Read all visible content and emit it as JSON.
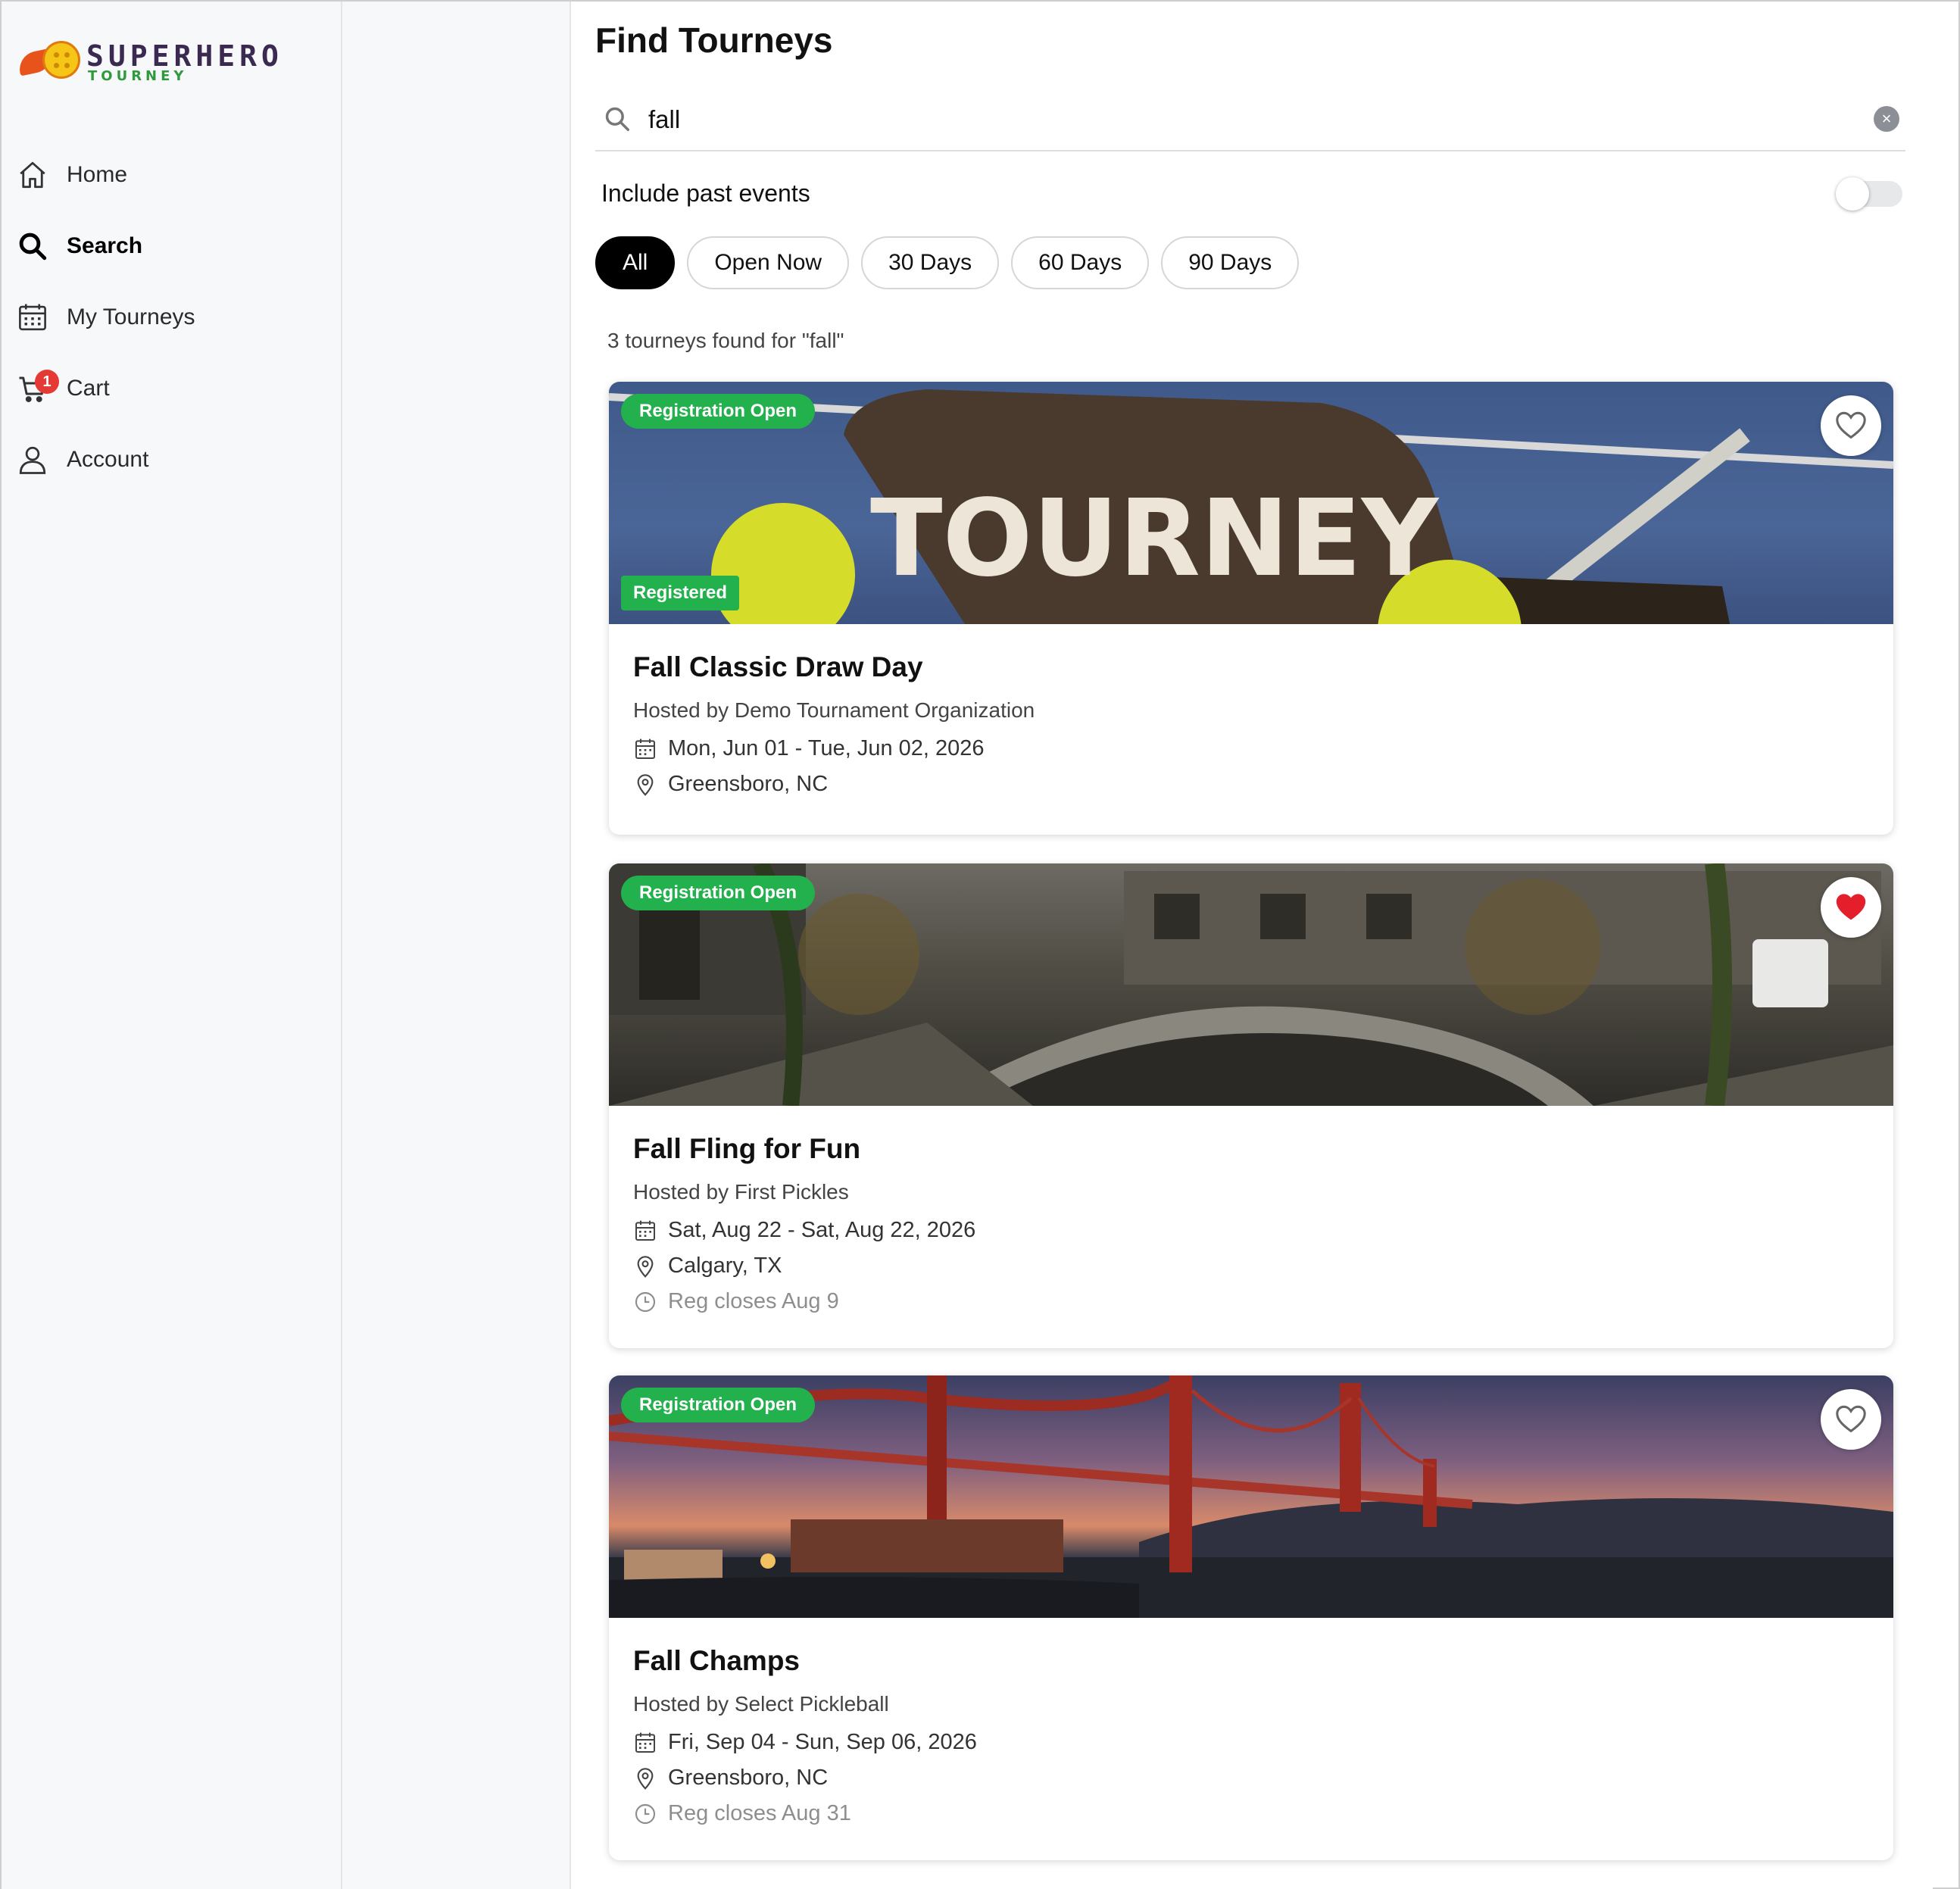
{
  "app": {
    "logo_text": "SUPERHERO",
    "logo_sub": "TOURNEY"
  },
  "sidebar": {
    "items": [
      {
        "label": "Home",
        "icon": "home-icon"
      },
      {
        "label": "Search",
        "icon": "search-icon",
        "active": true
      },
      {
        "label": "My Tourneys",
        "icon": "calendar-icon"
      },
      {
        "label": "Cart",
        "icon": "cart-icon",
        "badge": "1"
      },
      {
        "label": "Account",
        "icon": "user-icon"
      }
    ]
  },
  "page": {
    "title": "Find Tourneys"
  },
  "search": {
    "value": "fall",
    "placeholder": "",
    "clear_symbol": "×"
  },
  "filters": {
    "past_label": "Include past events",
    "past_enabled": false,
    "chips": [
      "All",
      "Open Now",
      "30 Days",
      "60 Days",
      "90 Days"
    ],
    "active_chip": "All"
  },
  "results": {
    "summary": "3 tourneys found for \"fall\"",
    "cards": [
      {
        "status": "Registration Open",
        "registered": "Registered",
        "favorite": false,
        "title": "Fall Classic Draw Day",
        "host": "Hosted by Demo Tournament Organization",
        "dates": "Mon, Jun 01 - Tue, Jun 02, 2026",
        "location": "Greensboro, NC",
        "image_text": "TOURNEY"
      },
      {
        "status": "Registration Open",
        "favorite": true,
        "title": "Fall Fling for Fun",
        "host": "Hosted by First Pickles",
        "dates": "Sat, Aug 22 - Sat, Aug 22, 2026",
        "location": "Calgary, TX",
        "reg_closes": "Reg closes Aug 9"
      },
      {
        "status": "Registration Open",
        "favorite": false,
        "title": "Fall Champs",
        "host": "Hosted by Select Pickleball",
        "dates": "Fri, Sep 04 - Sun, Sep 06, 2026",
        "location": "Greensboro, NC",
        "reg_closes": "Reg closes Aug 31"
      }
    ]
  },
  "colors": {
    "status_green": "#22b14c",
    "badge_red": "#e53935",
    "heart_red": "#e41e2b"
  }
}
